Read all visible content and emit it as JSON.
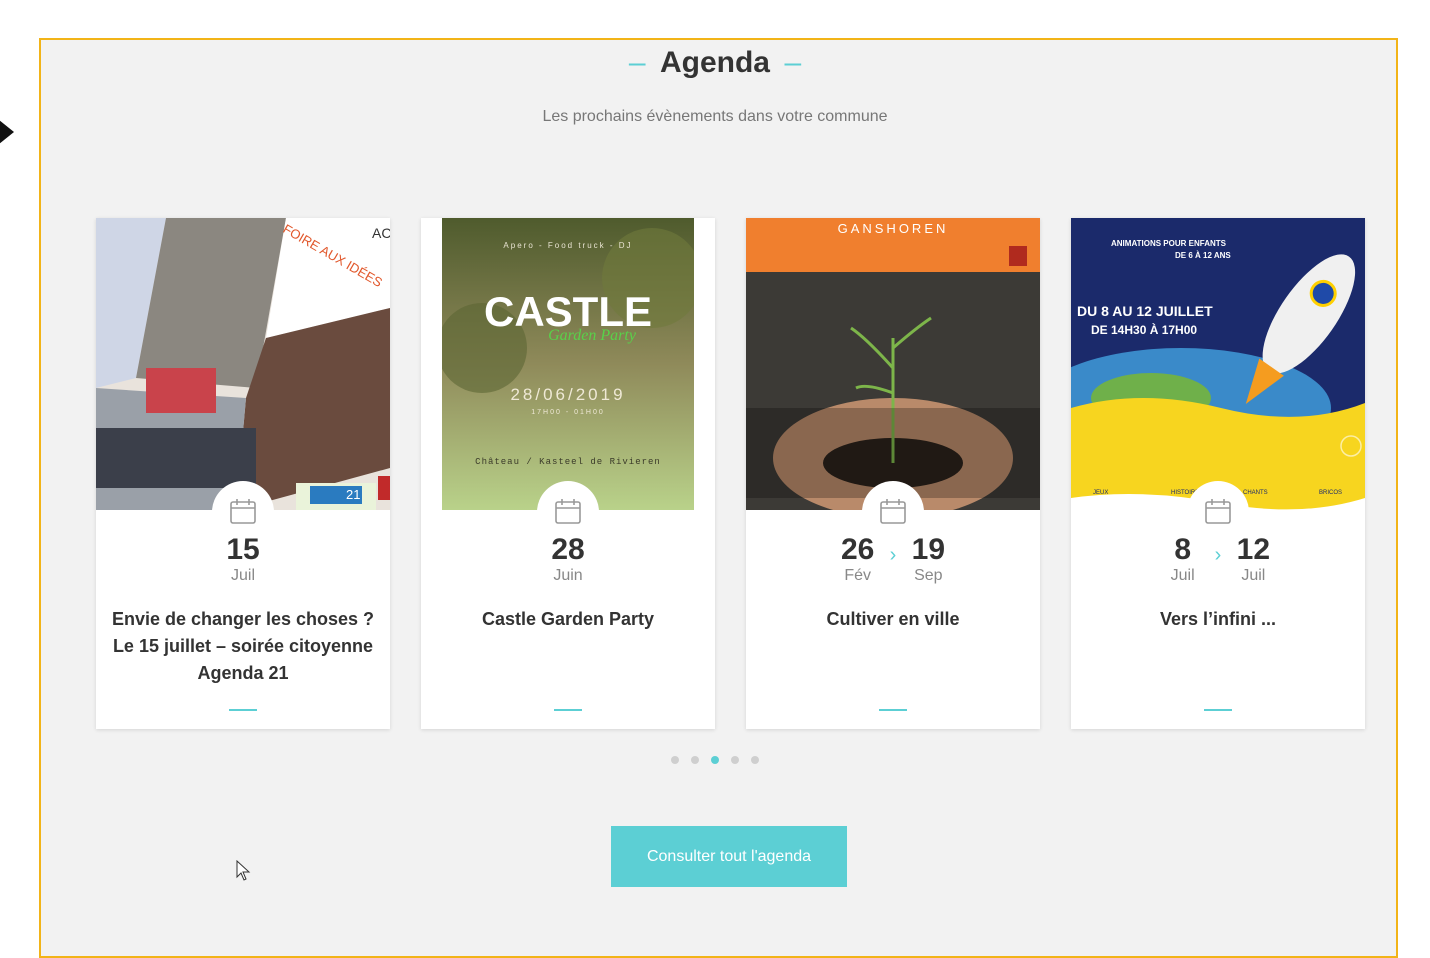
{
  "section": {
    "title": "Agenda",
    "subtitle": "Les prochains évènements dans votre commune"
  },
  "cards": [
    {
      "title": "Envie de changer les choses ?  Le 15 juillet – soirée citoyenne Agenda 21",
      "start_day": "15",
      "start_month": "Juil",
      "poster": {
        "header": "FOIRE AUX IDÉES",
        "corner": "AC",
        "badge": "21"
      }
    },
    {
      "title": "Castle Garden Party",
      "start_day": "28",
      "start_month": "Juin",
      "poster": {
        "top": "Apero - Food truck - DJ",
        "logo": "CASTLE",
        "script": "Garden Party",
        "date": "28/06/2019",
        "time": "17H00 - 01H00",
        "place": "Château / Kasteel de Rivieren"
      }
    },
    {
      "title": "Cultiver en ville",
      "start_day": "26",
      "start_month": "Fév",
      "end_day": "19",
      "end_month": "Sep",
      "poster": {
        "header": "GANSHOREN"
      }
    },
    {
      "title": "Vers l’infini ...",
      "start_day": "8",
      "start_month": "Juil",
      "end_day": "12",
      "end_month": "Juil",
      "poster": {
        "line1": "ANIMATIONS POUR ENFANTS",
        "line2": "DE 6 À 12 ANS",
        "line3": "DU 8 AU 12 JUILLET",
        "line4": "DE 14H30 À 17H00",
        "labels": [
          "JEUX",
          "HISTOIRE",
          "CHANTS",
          "BRICOS"
        ]
      }
    }
  ],
  "carousel": {
    "pages": 5,
    "active": 3
  },
  "cta_label": "Consulter tout l'agenda",
  "colors": {
    "accent": "#5ccfd4",
    "frame": "#f2b418",
    "background": "#f2f2f2"
  }
}
